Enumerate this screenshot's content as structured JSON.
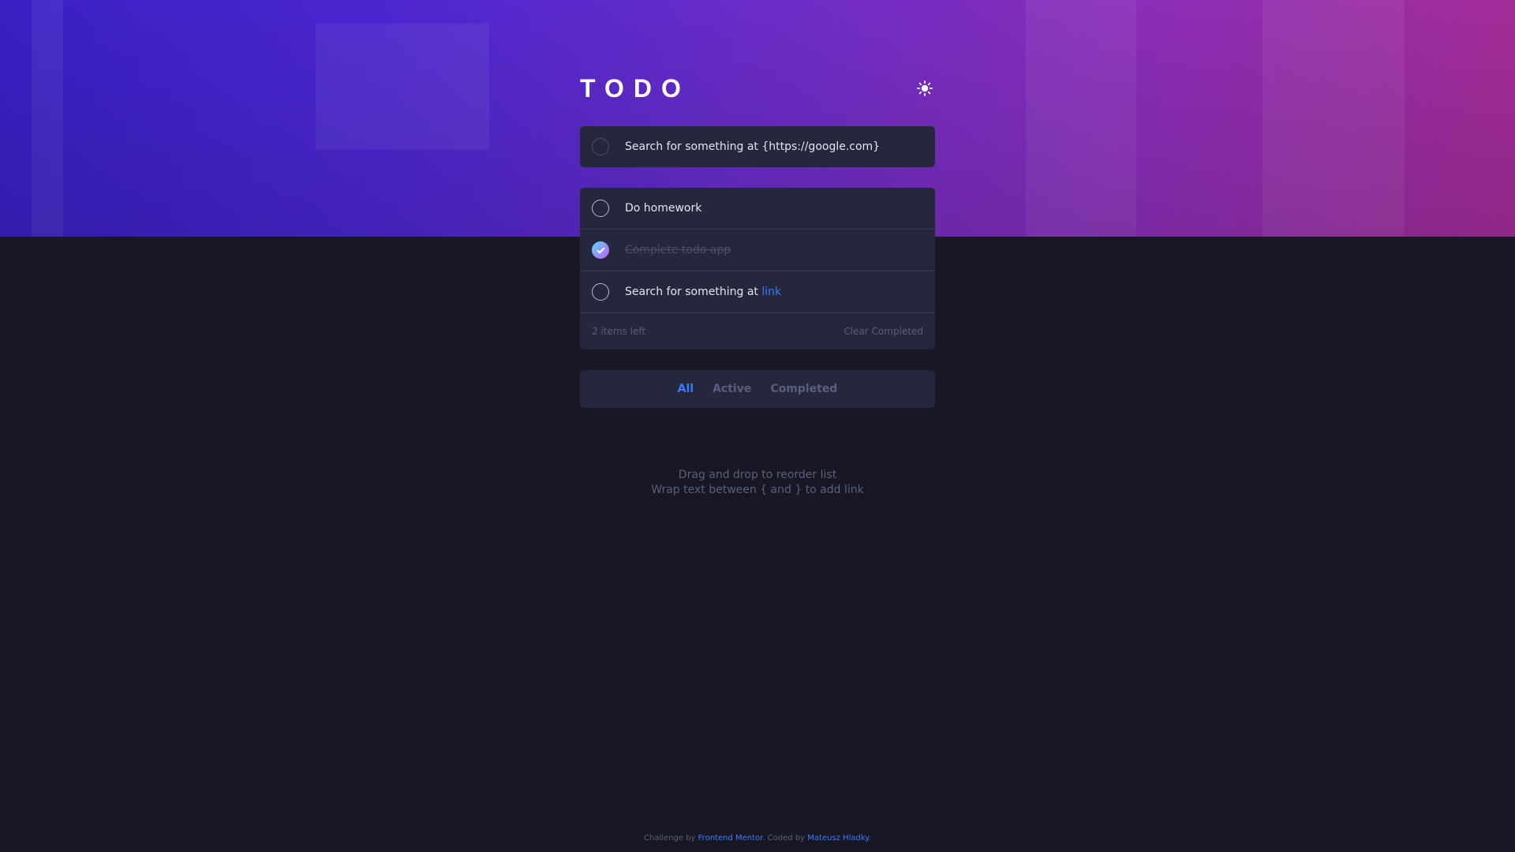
{
  "colors": {
    "page_background": "#181824",
    "card_background": "#25273c",
    "accent": "#3a7bfd",
    "hero_gradient_start": "#3a1fc4",
    "hero_gradient_end": "#a32c98",
    "check_gradient_start": "#57ddff",
    "check_gradient_end": "#c058f3"
  },
  "header": {
    "title": "TODO",
    "theme_toggle_icon": "sun-icon"
  },
  "new_todo": {
    "value": "Search for something at {https://google.com}",
    "placeholder": ""
  },
  "todos": [
    {
      "text": "Do homework",
      "completed": false
    },
    {
      "text": "Complete todo app",
      "completed": true
    },
    {
      "text_prefix": "Search for something at ",
      "link_text": "link",
      "completed": false
    }
  ],
  "list_footer": {
    "items_left": "2 items left",
    "clear_label": "Clear Completed"
  },
  "filters": {
    "all": "All",
    "active": "Active",
    "completed": "Completed",
    "selected": "All"
  },
  "hints": {
    "line1": "Drag and drop to reorder list",
    "line2": "Wrap text between { and } to add link"
  },
  "attribution": {
    "prefix": "Challenge by ",
    "link1": "Frontend Mentor",
    "middle": ". Coded by ",
    "link2": "Mateusz Hladky",
    "suffix": "."
  }
}
